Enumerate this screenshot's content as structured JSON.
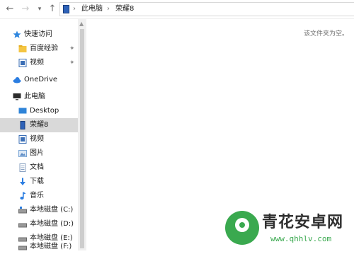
{
  "toolbar": {
    "back": "←",
    "forward": "→",
    "recent": "▾",
    "up": "↑"
  },
  "address": {
    "icon": "phone-icon",
    "separator": "›",
    "crumbs": [
      "此电脑",
      "荣耀8"
    ]
  },
  "sidebar": {
    "items": [
      {
        "label": "快速访问",
        "icon": "star-icon",
        "color": "#2e86de"
      },
      {
        "label": "百度经验",
        "icon": "folder-icon",
        "color": "#f4c542",
        "pinned": true
      },
      {
        "label": "视频",
        "icon": "video-icon",
        "color": "#3b6fb6",
        "pinned": true
      },
      {
        "label": "OneDrive",
        "icon": "cloud-icon",
        "color": "#2b7de1"
      },
      {
        "label": "此电脑",
        "icon": "computer-icon",
        "color": "#2b2b2b"
      },
      {
        "label": "Desktop",
        "icon": "desktop-icon",
        "color": "#2f84d8"
      },
      {
        "label": "荣耀8",
        "icon": "phone-icon",
        "color": "#2e62b8",
        "selected": true
      },
      {
        "label": "视频",
        "icon": "video-icon",
        "color": "#3b6fb6"
      },
      {
        "label": "图片",
        "icon": "picture-icon",
        "color": "#7aa6d6"
      },
      {
        "label": "文档",
        "icon": "document-icon",
        "color": "#8aa2c2"
      },
      {
        "label": "下载",
        "icon": "download-icon",
        "color": "#2b7de1"
      },
      {
        "label": "音乐",
        "icon": "music-icon",
        "color": "#2b7de1"
      },
      {
        "label": "本地磁盘 (C:)",
        "icon": "drive-icon",
        "color": "#6b6b6b"
      },
      {
        "label": "本地磁盘 (D:)",
        "icon": "drive-icon",
        "color": "#6b6b6b"
      },
      {
        "label": "本地磁盘 (E:)",
        "icon": "drive-icon",
        "color": "#6b6b6b"
      },
      {
        "label": "本地磁盘 (F:)",
        "icon": "drive-icon",
        "color": "#6b6b6b"
      }
    ],
    "pin_glyph": "📌"
  },
  "content": {
    "empty_message": "该文件夹为空。"
  },
  "watermark": {
    "title": "青花安卓网",
    "url": "www.qhhlv.com",
    "color": "#3aa94f"
  }
}
